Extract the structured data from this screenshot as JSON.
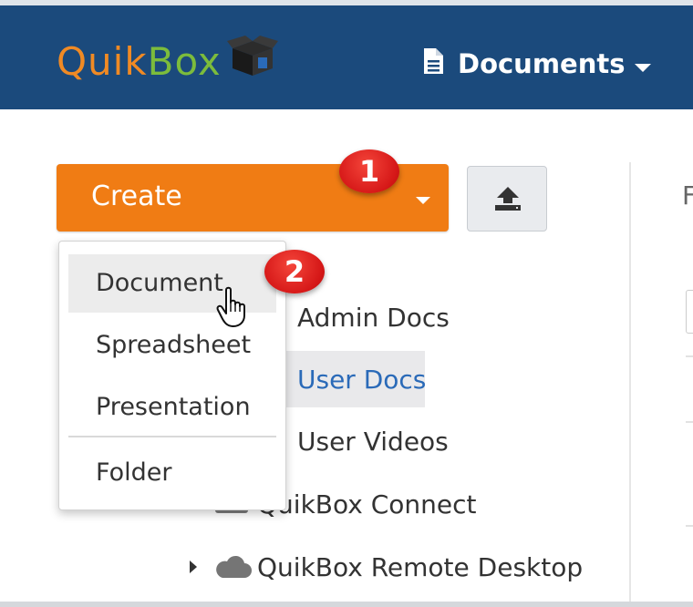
{
  "header": {
    "logo_quik": "Quik",
    "logo_box": "Box",
    "logo_icon": "box-icon",
    "documents_menu_label": "Documents",
    "documents_menu_icon": "document-icon",
    "colors": {
      "bar": "#1b4a7c",
      "logo_quik": "#f08a24",
      "logo_box": "#7cbc3c"
    }
  },
  "toolbar": {
    "create_label": "Create",
    "create_color": "#f07c14",
    "upload_icon": "upload-icon"
  },
  "create_menu": {
    "items": [
      {
        "label": "Document",
        "hovered": true
      },
      {
        "label": "Spreadsheet"
      },
      {
        "label": "Presentation"
      },
      {
        "label": "Folder"
      }
    ]
  },
  "tree": {
    "items": [
      {
        "label": "Admin Docs"
      },
      {
        "label": "User Docs",
        "selected": true
      },
      {
        "label": "User Videos"
      },
      {
        "label": "QuikBox Connect"
      },
      {
        "label": "QuikBox Remote Desktop"
      }
    ]
  },
  "annotations": {
    "step1": "1",
    "step2": "2",
    "badge_color": "#d51717"
  },
  "right_panel": {
    "cutoff_text": "F"
  }
}
